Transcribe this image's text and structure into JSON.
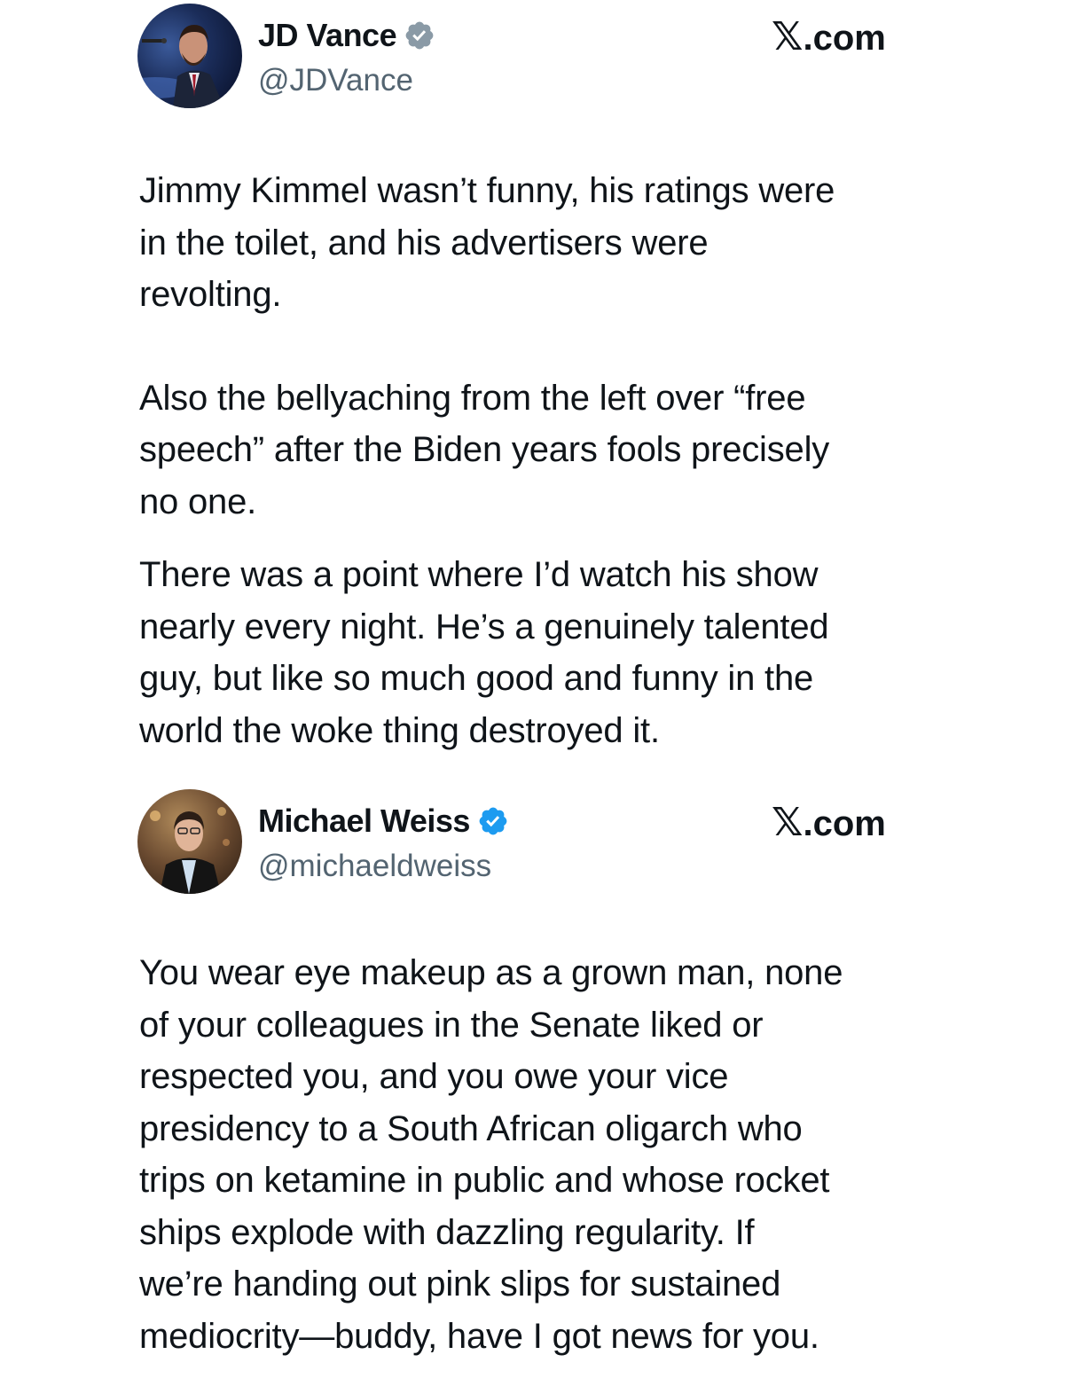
{
  "posts": [
    {
      "author": {
        "name": "JD Vance",
        "handle": "@JDVance",
        "avatar_icon": "jd-vance-avatar-photo",
        "verified_badge_color": "#8a9aa6"
      },
      "site_logo": "𝕏",
      "site_label": ".com",
      "paragraphs": [
        [
          "Jimmy Kimmel wasn’t funny, his ratings were",
          "in the toilet, and his advertisers were",
          "revolting."
        ],
        [
          "Also the bellyaching from the left over “free",
          "speech” after the Biden years fools precisely",
          "no one."
        ],
        [
          "There was a point where I’d watch his show",
          "nearly every night.  He’s a genuinely talented",
          "guy, but like so much good and funny in the",
          "world the woke thing destroyed it."
        ]
      ]
    },
    {
      "author": {
        "name": "Michael Weiss",
        "handle": "@michaeldweiss",
        "avatar_icon": "michael-weiss-avatar-photo",
        "verified_badge_color": "#1d9bf0"
      },
      "site_logo": "𝕏",
      "site_label": ".com",
      "paragraphs": [
        [
          "You wear eye makeup as a grown man, none",
          "of your colleagues in the Senate liked or",
          "respected you, and you owe your vice",
          "presidency to a South African oligarch who",
          "trips on ketamine in public and whose rocket",
          "ships explode with dazzling regularity. If",
          "we’re handing out pink slips for sustained",
          "mediocrity—buddy, have I got news for you."
        ]
      ]
    }
  ]
}
